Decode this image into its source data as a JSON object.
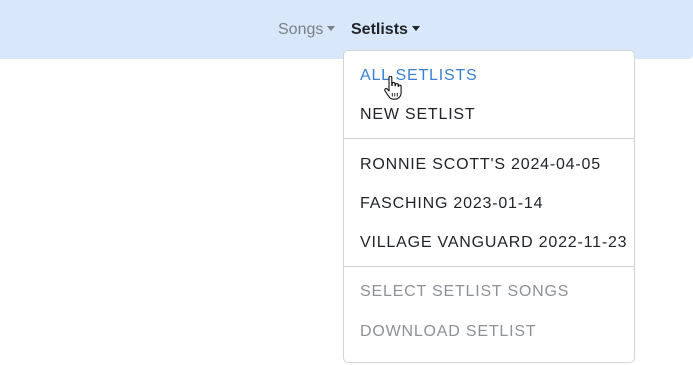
{
  "navbar": {
    "songs_label": "Songs",
    "setlists_label": "Setlists",
    "background": "#d8e8fa"
  },
  "dropdown": {
    "items": [
      {
        "label": "ALL SETLISTS",
        "state": "active"
      },
      {
        "label": "NEW SETLIST",
        "state": "normal"
      },
      {
        "label": "RONNIE SCOTT'S 2024-04-05",
        "state": "normal"
      },
      {
        "label": "FASCHING 2023-01-14",
        "state": "normal"
      },
      {
        "label": "VILLAGE VANGUARD 2022-11-23",
        "state": "normal"
      },
      {
        "label": "SELECT SETLIST SONGS",
        "state": "disabled"
      },
      {
        "label": "DOWNLOAD SETLIST",
        "state": "disabled"
      }
    ]
  },
  "colors": {
    "accent": "#3a7fd5",
    "disabled": "#8d9297",
    "text": "#212529"
  },
  "cursor": {
    "icon": "hand-pointer-icon"
  }
}
